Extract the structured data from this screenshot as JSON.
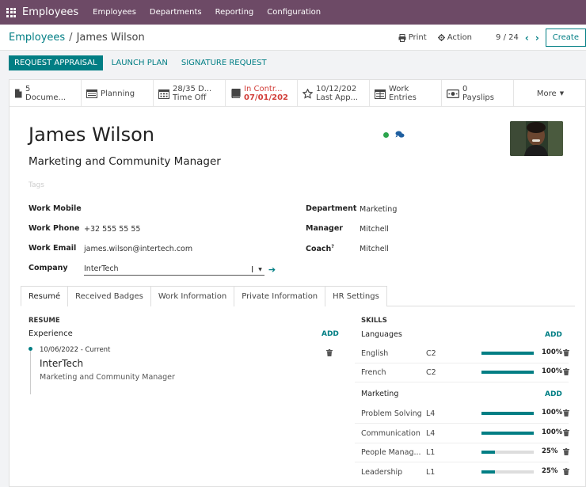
{
  "app": {
    "name": "Employees",
    "nav": [
      "Employees",
      "Departments",
      "Reporting",
      "Configuration"
    ]
  },
  "breadcrumb": {
    "parent": "Employees",
    "separator": "/",
    "current": "James Wilson"
  },
  "controls": {
    "print": "Print",
    "action": "Action",
    "pager": "9 / 24",
    "create": "Create"
  },
  "actions": {
    "request_appraisal": "REQUEST APPRAISAL",
    "launch_plan": "LAUNCH PLAN",
    "signature_request": "SIGNATURE REQUEST"
  },
  "smart_buttons": [
    {
      "line1": "5",
      "line2": "Docume...",
      "icon": "document-icon"
    },
    {
      "line1": "Planning",
      "line2": "",
      "icon": "planning-icon"
    },
    {
      "line1": "28/35 D...",
      "line2": "Time Off",
      "icon": "calendar-icon"
    },
    {
      "line1": "In Contr...",
      "line2": "07/01/202",
      "icon": "book-icon"
    },
    {
      "line1": "10/12/202",
      "line2": "Last App...",
      "icon": "star-icon"
    },
    {
      "line1": "Work",
      "line2": "Entries",
      "icon": "work-entries-icon"
    },
    {
      "line1": "0",
      "line2": "Payslips",
      "icon": "payslip-icon"
    },
    {
      "line1": "More",
      "line2": "",
      "icon": "caret-down-icon"
    }
  ],
  "employee": {
    "name": "James Wilson",
    "job_title": "Marketing and Community Manager",
    "tags_placeholder": "Tags",
    "status_color": "#2ba44c"
  },
  "fields_left": [
    {
      "label": "Work Mobile",
      "value": ""
    },
    {
      "label": "Work Phone",
      "value": "+32 555 55 55"
    },
    {
      "label": "Work Email",
      "value": "james.wilson@intertech.com"
    },
    {
      "label": "Company",
      "value": "InterTech"
    }
  ],
  "fields_right": [
    {
      "label": "Department",
      "value": "Marketing"
    },
    {
      "label": "Manager",
      "value": "Mitchell"
    },
    {
      "label": "Coach",
      "value": "Mitchell",
      "superscript": "?"
    }
  ],
  "tabs": [
    "Resumé",
    "Received Badges",
    "Work Information",
    "Private Information",
    "HR Settings"
  ],
  "resume": {
    "section_title": "RESUME",
    "group": "Experience",
    "add_label": "ADD",
    "entry": {
      "date": "10/06/2022 - Current",
      "org": "InterTech",
      "role": "Marketing and Community Manager"
    }
  },
  "skills": {
    "section_title": "SKILLS",
    "add_label": "ADD",
    "groups": [
      {
        "name": "Languages",
        "items": [
          {
            "name": "English",
            "level": "C2",
            "progress": 100,
            "pct": "100%"
          },
          {
            "name": "French",
            "level": "C2",
            "progress": 100,
            "pct": "100%"
          }
        ]
      },
      {
        "name": "Marketing",
        "items": [
          {
            "name": "Problem Solving",
            "level": "L4",
            "progress": 100,
            "pct": "100%"
          },
          {
            "name": "Communication",
            "level": "L4",
            "progress": 100,
            "pct": "100%"
          },
          {
            "name": "People Manag...",
            "level": "L1",
            "progress": 25,
            "pct": "25%"
          },
          {
            "name": "Leadership",
            "level": "L1",
            "progress": 25,
            "pct": "25%"
          }
        ]
      }
    ]
  },
  "colors": {
    "brand": "#6d4a66",
    "accent": "#017e84",
    "danger": "#d23f3a"
  }
}
